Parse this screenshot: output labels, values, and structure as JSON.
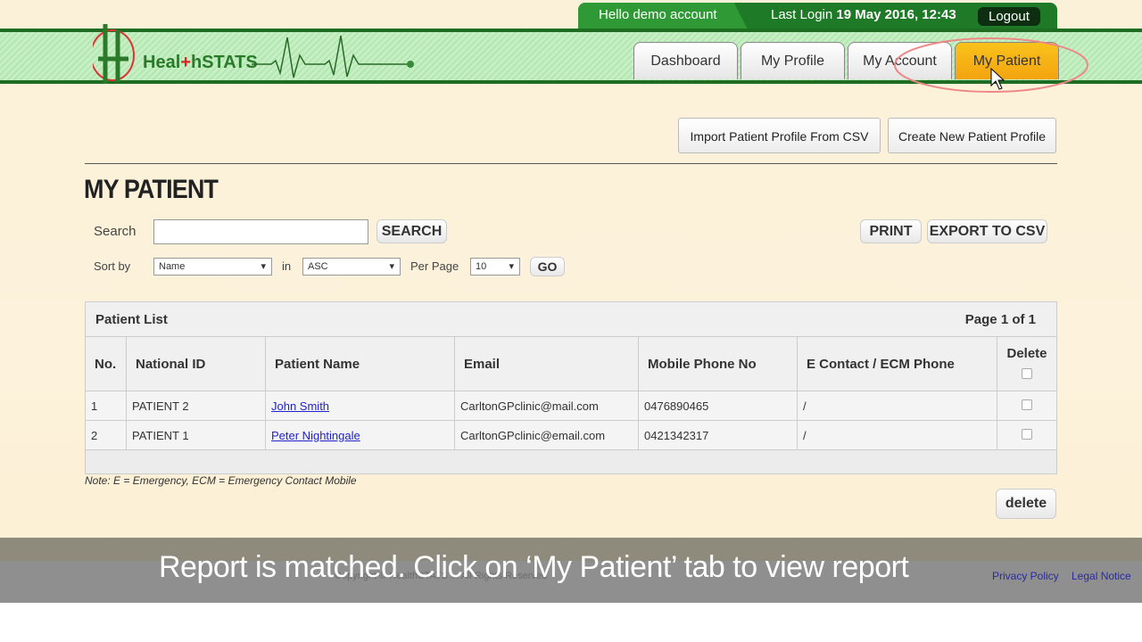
{
  "header": {
    "hello": "Hello demo account",
    "last_login_label": "Last Login",
    "last_login_value": "19 May 2016, 12:43",
    "logout": "Logout",
    "logo_text": "HealthSTATS"
  },
  "tabs": [
    {
      "label": "Dashboard"
    },
    {
      "label": "My Profile"
    },
    {
      "label": "My Account"
    },
    {
      "label": "My Patient",
      "active": true
    }
  ],
  "actions": {
    "import": "Import Patient Profile From CSV",
    "create": "Create New Patient Profile"
  },
  "page_title": "MY PATIENT",
  "search": {
    "label": "Search",
    "value": "",
    "button": "SEARCH",
    "print": "PRINT",
    "export": "EXPORT TO CSV"
  },
  "sort": {
    "label": "Sort by",
    "field": "Name",
    "in": "in",
    "order": "ASC",
    "per_page_label": "Per Page",
    "per_page": "10",
    "go": "GO"
  },
  "list": {
    "title": "Patient List",
    "page": "Page 1 of 1",
    "columns": [
      "No.",
      "National ID",
      "Patient Name",
      "Email",
      "Mobile Phone No",
      "E Contact / ECM Phone",
      "Delete"
    ],
    "rows": [
      {
        "no": "1",
        "nid": "PATIENT 2",
        "name": "John Smith",
        "email": "CarltonGPclinic@mail.com",
        "mobile": "0476890465",
        "ecm": "/"
      },
      {
        "no": "2",
        "nid": "PATIENT 1",
        "name": "Peter Nightingale",
        "email": "CarltonGPclinic@email.com",
        "mobile": "0421342317",
        "ecm": "/"
      }
    ]
  },
  "note": "Note: E = Emergency, ECM = Emergency Contact Mobile",
  "delete_button": "delete",
  "footer": {
    "copyright": "Copyright © HealthSTATS ... All Rights Reserved",
    "privacy": "Privacy Policy",
    "legal": "Legal Notice"
  },
  "caption": "Report is matched. Click on ‘My Patient’ tab to view report",
  "colors": {
    "green": "#1e7a26",
    "active_tab": "#f5b015",
    "link": "#2222cc"
  }
}
